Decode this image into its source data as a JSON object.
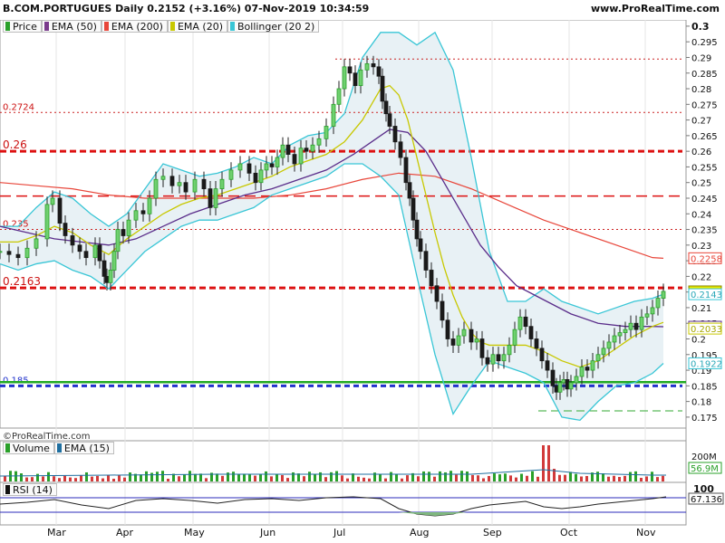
{
  "header": {
    "title": "B.COM.PORTUGUES Daily 0.2152 (+3.16%) 07-Nov-2019 10:34:59",
    "site": "www.ProRealTime.com",
    "watermark": "©ProRealTime.com"
  },
  "legends": {
    "price": [
      {
        "label": "Price",
        "color": "#2aa02a"
      },
      {
        "label": "EMA (50)",
        "color": "#7a3a8c"
      },
      {
        "label": "EMA (200)",
        "color": "#e8463a"
      },
      {
        "label": "EMA (20)",
        "color": "#c8c800"
      },
      {
        "label": "Bollinger (20 2)",
        "color": "#39c6d6"
      }
    ],
    "volume": [
      {
        "label": "Volume",
        "color": "#2aa02a"
      },
      {
        "label": "EMA (15)",
        "color": "#1f6fa0"
      }
    ],
    "rsi": [
      {
        "label": "RSI (14)",
        "color": "#111111"
      }
    ]
  },
  "chart_data": {
    "type": "candlestick",
    "title": "B.COM.PORTUGUES Daily 0.2152 (+3.16%) 07-Nov-2019 10:34:59",
    "x_labels": [
      "Mar",
      "Apr",
      "May",
      "Jun",
      "Jul",
      "Aug",
      "Sep",
      "Oct",
      "Nov"
    ],
    "y_ticks": [
      "0.3",
      "0.295",
      "0.29",
      "0.285",
      "0.28",
      "0.275",
      "0.27",
      "0.265",
      "0.26",
      "0.255",
      "0.25",
      "0.245",
      "0.24",
      "0.235",
      "0.23",
      "0.225",
      "0.22",
      "0.215",
      "0.21",
      "0.205",
      "0.2",
      "0.195",
      "0.19",
      "0.185",
      "0.18",
      "0.175"
    ],
    "ylim": [
      0.1715,
      0.302
    ],
    "price_series": [
      {
        "name": "Price",
        "color": "#2aa02a",
        "x": [
          0,
          10,
          20,
          30,
          40,
          52,
          58,
          66,
          72,
          80,
          88,
          95,
          105,
          110,
          115,
          118,
          122,
          126,
          130,
          136,
          142,
          150,
          158,
          165,
          172,
          180,
          190,
          198,
          205,
          215,
          225,
          232,
          238,
          245,
          255,
          265,
          275,
          282,
          288,
          294,
          300,
          306,
          312,
          318,
          325,
          332,
          338,
          345,
          352,
          360,
          368,
          374,
          380,
          386,
          392,
          398,
          405,
          412,
          418,
          422,
          426,
          430,
          436,
          442,
          448,
          452,
          456,
          460,
          464,
          470,
          476,
          482,
          488,
          494,
          500,
          506,
          512,
          520,
          526,
          532,
          538,
          544,
          550,
          556,
          562,
          568,
          574,
          580,
          586,
          592,
          598,
          604,
          610,
          614,
          618,
          622,
          626,
          630,
          636,
          642,
          648,
          654,
          660,
          666,
          672,
          678,
          684,
          690,
          696,
          702,
          708,
          714,
          720,
          726,
          732
        ],
        "y": [
          0.228,
          0.227,
          0.226,
          0.229,
          0.232,
          0.243,
          0.245,
          0.237,
          0.233,
          0.23,
          0.228,
          0.226,
          0.23,
          0.225,
          0.22,
          0.218,
          0.222,
          0.228,
          0.235,
          0.233,
          0.238,
          0.241,
          0.24,
          0.245,
          0.251,
          0.252,
          0.249,
          0.25,
          0.247,
          0.251,
          0.248,
          0.242,
          0.248,
          0.251,
          0.254,
          0.256,
          0.253,
          0.25,
          0.254,
          0.256,
          0.255,
          0.258,
          0.262,
          0.259,
          0.256,
          0.261,
          0.26,
          0.262,
          0.264,
          0.268,
          0.275,
          0.28,
          0.287,
          0.285,
          0.281,
          0.286,
          0.288,
          0.287,
          0.284,
          0.276,
          0.272,
          0.268,
          0.263,
          0.258,
          0.25,
          0.245,
          0.238,
          0.232,
          0.228,
          0.222,
          0.217,
          0.212,
          0.206,
          0.2,
          0.198,
          0.201,
          0.203,
          0.199,
          0.2,
          0.194,
          0.192,
          0.195,
          0.193,
          0.195,
          0.198,
          0.203,
          0.207,
          0.204,
          0.2,
          0.197,
          0.193,
          0.19,
          0.185,
          0.183,
          0.186,
          0.187,
          0.184,
          0.186,
          0.188,
          0.191,
          0.19,
          0.193,
          0.195,
          0.197,
          0.199,
          0.201,
          0.202,
          0.203,
          0.205,
          0.203,
          0.207,
          0.208,
          0.21,
          0.213,
          0.2152
        ]
      }
    ],
    "ema20": {
      "name": "EMA (20)",
      "color": "#c8c800",
      "x": [
        0,
        20,
        40,
        60,
        80,
        100,
        120,
        140,
        160,
        180,
        200,
        220,
        240,
        260,
        280,
        300,
        320,
        340,
        360,
        380,
        400,
        410,
        420,
        430,
        440,
        450,
        460,
        470,
        480,
        490,
        500,
        510,
        520,
        530,
        540,
        560,
        580,
        600,
        620,
        640,
        660,
        680,
        700,
        720,
        732
      ],
      "y": [
        0.231,
        0.231,
        0.233,
        0.236,
        0.234,
        0.23,
        0.227,
        0.232,
        0.236,
        0.24,
        0.243,
        0.245,
        0.246,
        0.248,
        0.25,
        0.252,
        0.255,
        0.257,
        0.259,
        0.263,
        0.27,
        0.275,
        0.28,
        0.281,
        0.278,
        0.27,
        0.258,
        0.246,
        0.234,
        0.223,
        0.214,
        0.207,
        0.202,
        0.199,
        0.198,
        0.198,
        0.198,
        0.196,
        0.193,
        0.191,
        0.193,
        0.197,
        0.201,
        0.204,
        0.2053
      ]
    },
    "ema50": {
      "name": "EMA (50)",
      "color": "#5a2d8a",
      "x": [
        0,
        30,
        60,
        90,
        120,
        150,
        180,
        210,
        240,
        270,
        300,
        330,
        360,
        390,
        410,
        430,
        450,
        470,
        490,
        510,
        530,
        550,
        570,
        590,
        610,
        630,
        660,
        690,
        720,
        732
      ],
      "y": [
        0.236,
        0.234,
        0.232,
        0.231,
        0.23,
        0.232,
        0.236,
        0.24,
        0.243,
        0.246,
        0.248,
        0.251,
        0.254,
        0.259,
        0.263,
        0.267,
        0.266,
        0.26,
        0.25,
        0.24,
        0.23,
        0.223,
        0.217,
        0.214,
        0.211,
        0.208,
        0.205,
        0.204,
        0.204,
        0.2039
      ]
    },
    "ema200": {
      "name": "EMA (200)",
      "color": "#e8463a",
      "x": [
        0,
        40,
        80,
        120,
        160,
        200,
        240,
        280,
        320,
        360,
        400,
        440,
        480,
        520,
        560,
        600,
        640,
        680,
        720,
        732
      ],
      "y": [
        0.25,
        0.249,
        0.248,
        0.246,
        0.245,
        0.245,
        0.245,
        0.245,
        0.246,
        0.248,
        0.251,
        0.253,
        0.252,
        0.248,
        0.243,
        0.238,
        0.234,
        0.23,
        0.226,
        0.2258
      ]
    },
    "bollinger_upper": {
      "name": "Bollinger upper",
      "color": "#39c6d6",
      "x": [
        0,
        20,
        40,
        60,
        80,
        100,
        120,
        140,
        160,
        180,
        200,
        220,
        240,
        260,
        280,
        300,
        320,
        340,
        360,
        380,
        400,
        420,
        440,
        460,
        480,
        500,
        520,
        540,
        560,
        580,
        600,
        620,
        640,
        660,
        680,
        700,
        720,
        732
      ],
      "y": [
        0.236,
        0.236,
        0.242,
        0.247,
        0.245,
        0.24,
        0.236,
        0.24,
        0.248,
        0.256,
        0.254,
        0.252,
        0.253,
        0.255,
        0.258,
        0.256,
        0.262,
        0.265,
        0.266,
        0.272,
        0.29,
        0.298,
        0.298,
        0.294,
        0.298,
        0.286,
        0.258,
        0.228,
        0.212,
        0.212,
        0.216,
        0.212,
        0.21,
        0.208,
        0.21,
        0.212,
        0.213,
        0.2143
      ]
    },
    "bollinger_lower": {
      "name": "Bollinger lower",
      "color": "#39c6d6",
      "x": [
        0,
        20,
        40,
        60,
        80,
        100,
        120,
        140,
        160,
        180,
        200,
        220,
        240,
        260,
        280,
        300,
        320,
        340,
        360,
        380,
        400,
        420,
        440,
        460,
        480,
        500,
        520,
        540,
        560,
        580,
        600,
        620,
        640,
        660,
        680,
        700,
        720,
        732
      ],
      "y": [
        0.224,
        0.222,
        0.224,
        0.225,
        0.222,
        0.22,
        0.216,
        0.222,
        0.228,
        0.232,
        0.236,
        0.238,
        0.238,
        0.24,
        0.242,
        0.246,
        0.248,
        0.25,
        0.252,
        0.256,
        0.256,
        0.252,
        0.246,
        0.22,
        0.195,
        0.176,
        0.185,
        0.193,
        0.191,
        0.189,
        0.186,
        0.175,
        0.174,
        0.18,
        0.185,
        0.186,
        0.189,
        0.1922
      ]
    },
    "horizontal_levels": [
      {
        "value": 0.2724,
        "label": "0.2724",
        "color": "#cc2222",
        "style": "dotted-thin"
      },
      {
        "value": 0.26,
        "label": "0.26",
        "color": "#dd1111",
        "style": "dashed-bold"
      },
      {
        "value": 0.2457,
        "label": "",
        "color": "#dd1111",
        "style": "dashed"
      },
      {
        "value": 0.235,
        "label": "0.235",
        "color": "#cc2222",
        "style": "dotted-thin"
      },
      {
        "value": 0.2163,
        "label": "0.2163",
        "color": "#dd1111",
        "style": "dashed-bold"
      },
      {
        "value": 0.185,
        "label": "0.185",
        "color": "#2233cc",
        "style": "dashed-bold-blue"
      },
      {
        "value": 0.2895,
        "label": "",
        "color": "#cc2222",
        "style": "dotted-thin"
      },
      {
        "value": 0.177,
        "label": "",
        "color": "#33aa33",
        "style": "dashed-green"
      }
    ],
    "support_line": {
      "value": 0.1862,
      "color": "#22aa22"
    },
    "right_badges": [
      {
        "value": 0.2258,
        "label": "0.2258",
        "bg": "#ffffff",
        "fg": "#e8463a",
        "border": "#e8463a"
      },
      {
        "value": 0.2152,
        "label": "0.2152",
        "bg": "#e8e800",
        "fg": "#111111",
        "border": "#888800"
      },
      {
        "value": 0.2143,
        "label": "0.2143",
        "bg": "#ffffff",
        "fg": "#2aa8b8",
        "border": "#39c6d6"
      },
      {
        "value": 0.2039,
        "label": "0.2039",
        "bg": "#ffffff",
        "fg": "#5a2d8a",
        "border": "#5a2d8a"
      },
      {
        "value": 0.2033,
        "label": "0.2033",
        "bg": "#ffffff",
        "fg": "#a8a800",
        "border": "#c8c800"
      },
      {
        "value": 0.1922,
        "label": "0.1922",
        "bg": "#ffffff",
        "fg": "#2aa8b8",
        "border": "#39c6d6"
      }
    ],
    "volume": {
      "ytick": "200M",
      "badge": "56.9M"
    },
    "rsi": {
      "ytick": "100",
      "badge": "67.136"
    }
  }
}
